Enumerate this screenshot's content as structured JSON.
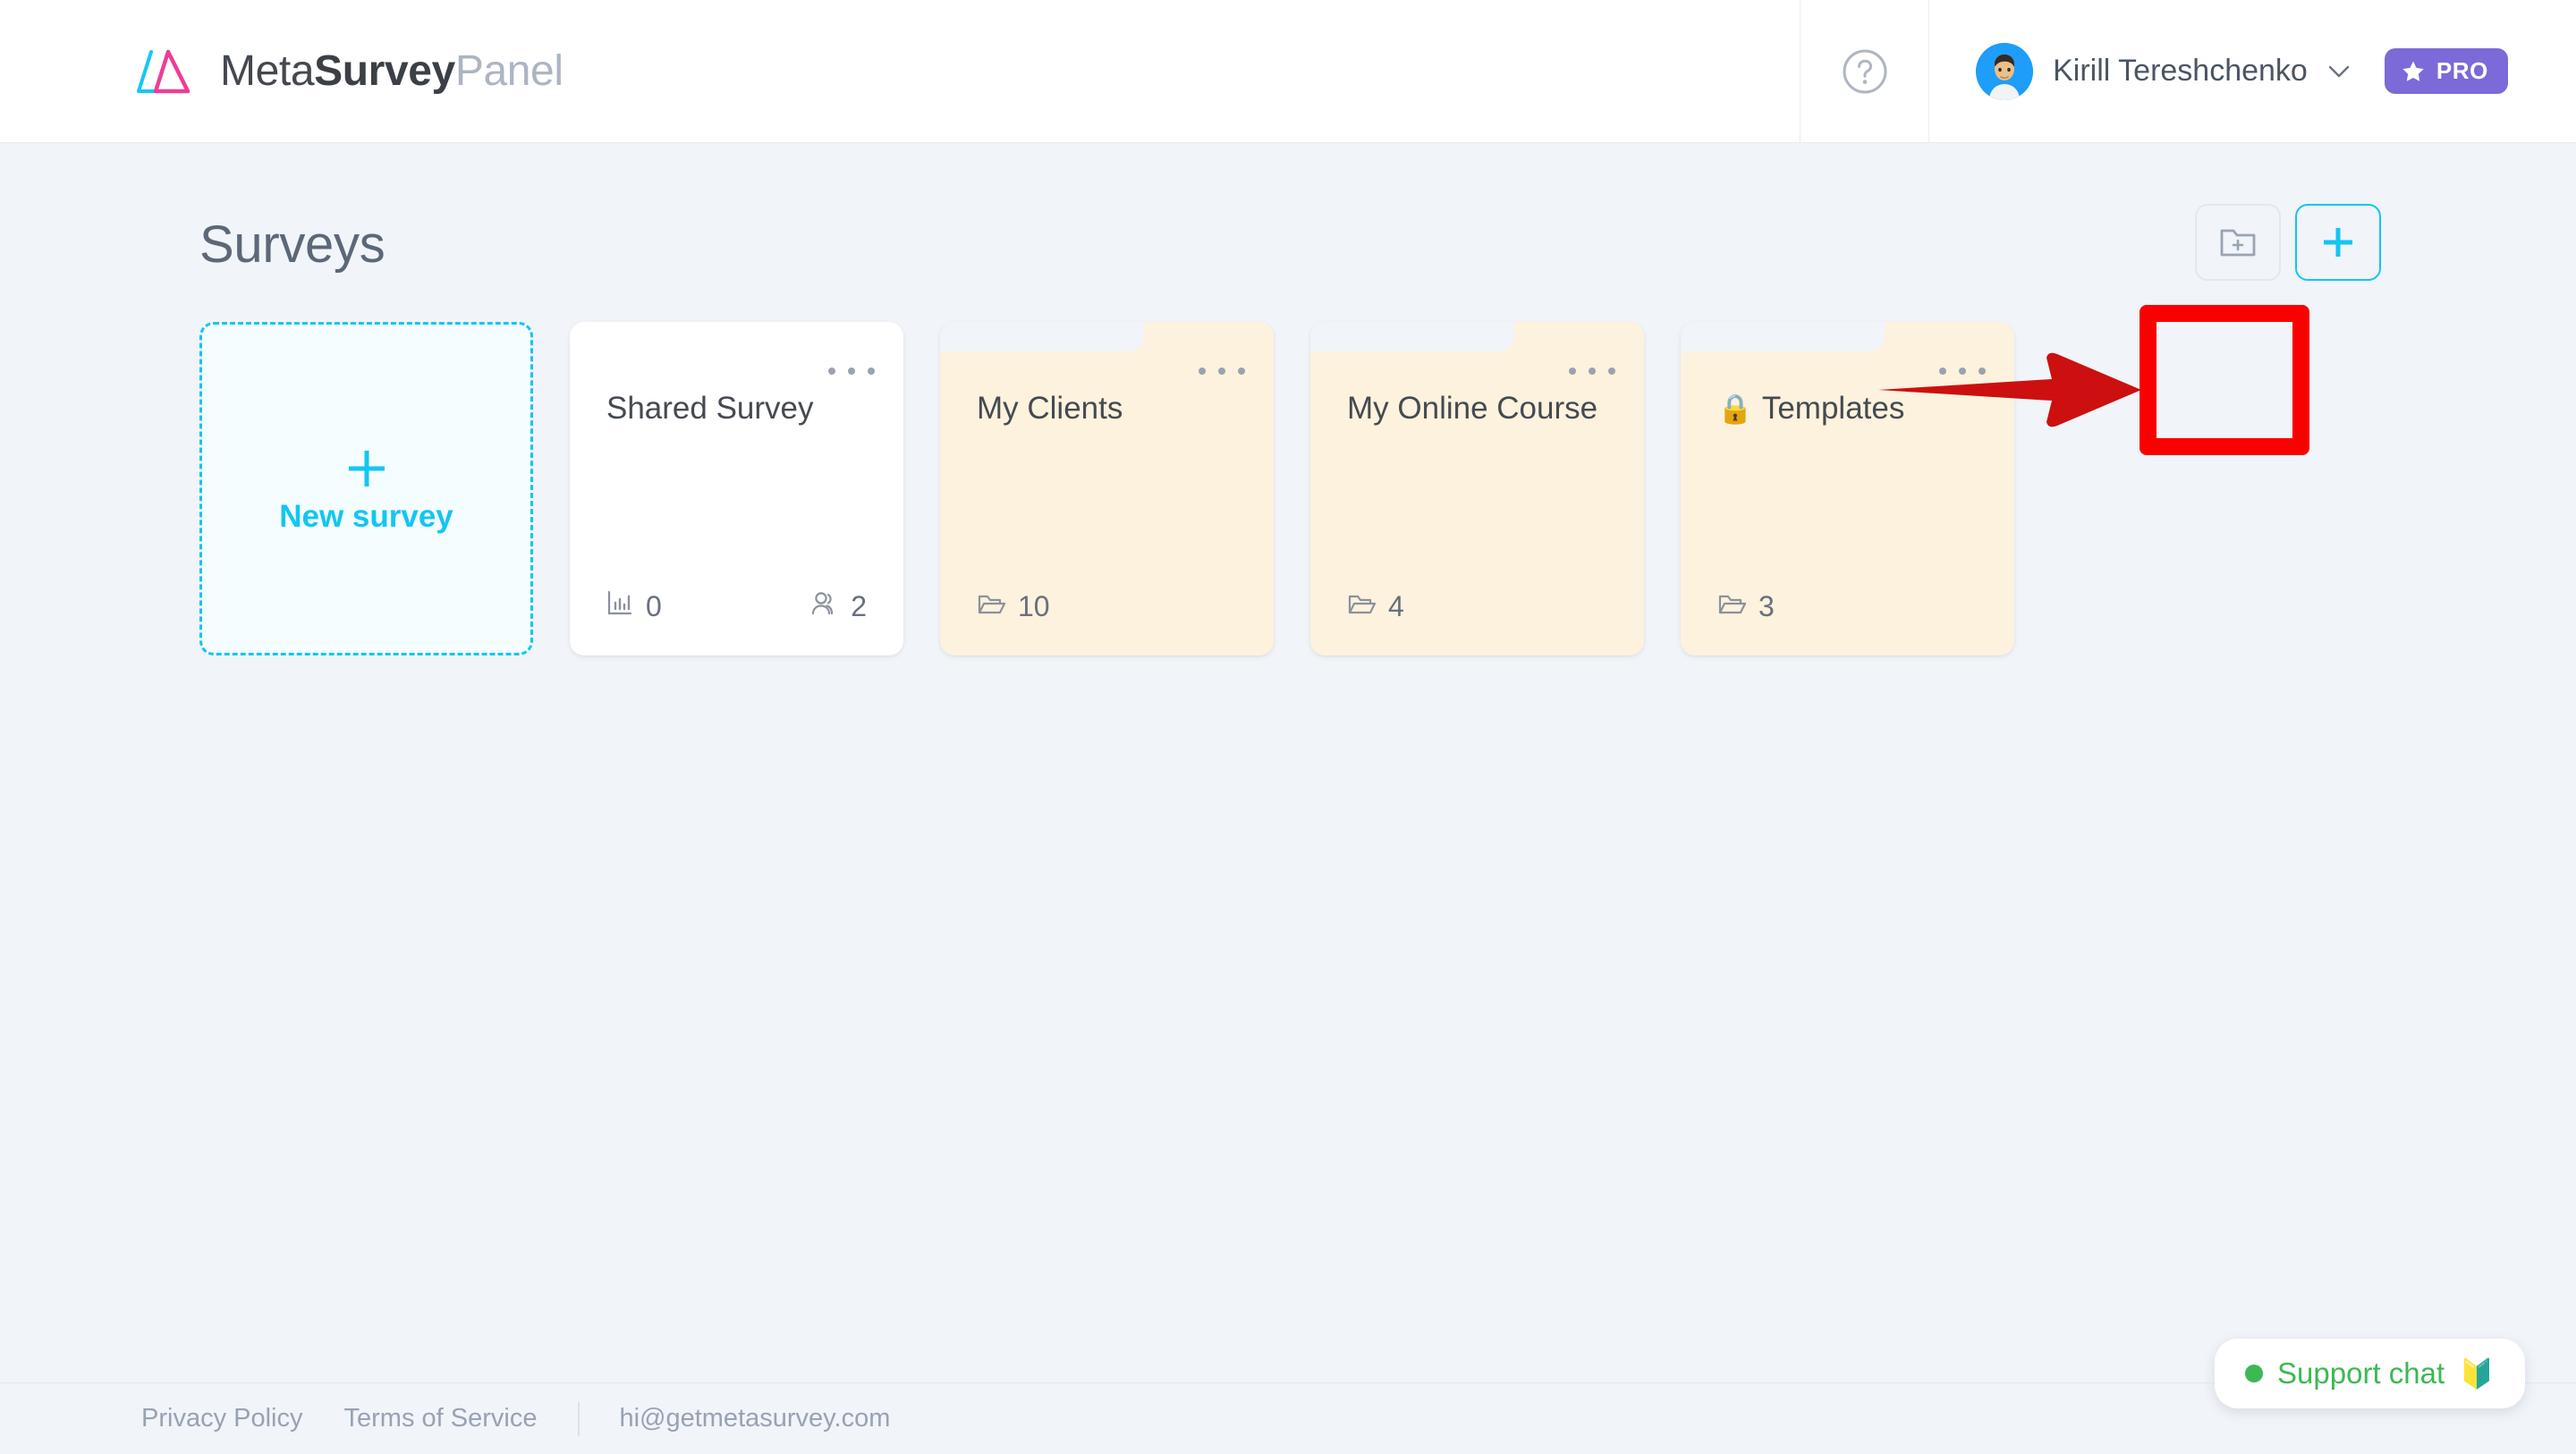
{
  "header": {
    "logo_icon": "metasurvey-triangles-logo",
    "logo_colors": {
      "cyan": "#14c8f5",
      "pink": "#ee3d96"
    },
    "brand": {
      "part1": "Meta",
      "part2": "Survey",
      "part3": "Panel"
    },
    "help_icon": "help-circle-icon",
    "user": {
      "avatar_icon": "user-avatar",
      "name": "Kirill Tereshchenko",
      "chevron_icon": "chevron-down-icon"
    },
    "pro_badge": {
      "label": "PRO",
      "icon": "star-icon",
      "color": "#7b6ad8"
    }
  },
  "main": {
    "title": "Surveys",
    "toolbar": {
      "new_folder": {
        "icon": "folder-plus-icon",
        "label": ""
      },
      "new_item": {
        "icon": "plus-icon",
        "label": "",
        "color": "#12c5f0"
      }
    },
    "annotation": {
      "arrow_icon": "red-arrow-right",
      "arrow_color": "#cc1010",
      "highlight_color": "#fb0000",
      "highlights": "new-folder-button"
    },
    "new_survey_card": {
      "icon": "plus-icon",
      "label": "New survey",
      "color": "#13c6f2"
    },
    "cards": [
      {
        "type": "survey",
        "title": "Shared Survey",
        "locked": false,
        "menu_icon": "ellipsis-icon",
        "stats": [
          {
            "icon": "bar-chart-icon",
            "value": "0"
          },
          {
            "icon": "people-icon",
            "value": "2"
          }
        ]
      },
      {
        "type": "folder",
        "title": "My Clients",
        "locked": false,
        "menu_icon": "ellipsis-icon",
        "stats": [
          {
            "icon": "folder-open-icon",
            "value": "10"
          }
        ]
      },
      {
        "type": "folder",
        "title": "My Online Course",
        "locked": false,
        "menu_icon": "ellipsis-icon",
        "stats": [
          {
            "icon": "folder-open-icon",
            "value": "4"
          }
        ]
      },
      {
        "type": "folder",
        "title": "Templates",
        "locked": true,
        "lock_emoji": "🔒",
        "menu_icon": "ellipsis-icon",
        "stats": [
          {
            "icon": "folder-open-icon",
            "value": "3"
          }
        ]
      }
    ]
  },
  "footer": {
    "privacy": "Privacy Policy",
    "terms": "Terms of Service",
    "email": "hi@getmetasurvey.com"
  },
  "support_chat": {
    "status_icon": "green-status-dot",
    "label": "Support chat",
    "emoji": "🔰",
    "color": "#3cb954"
  }
}
